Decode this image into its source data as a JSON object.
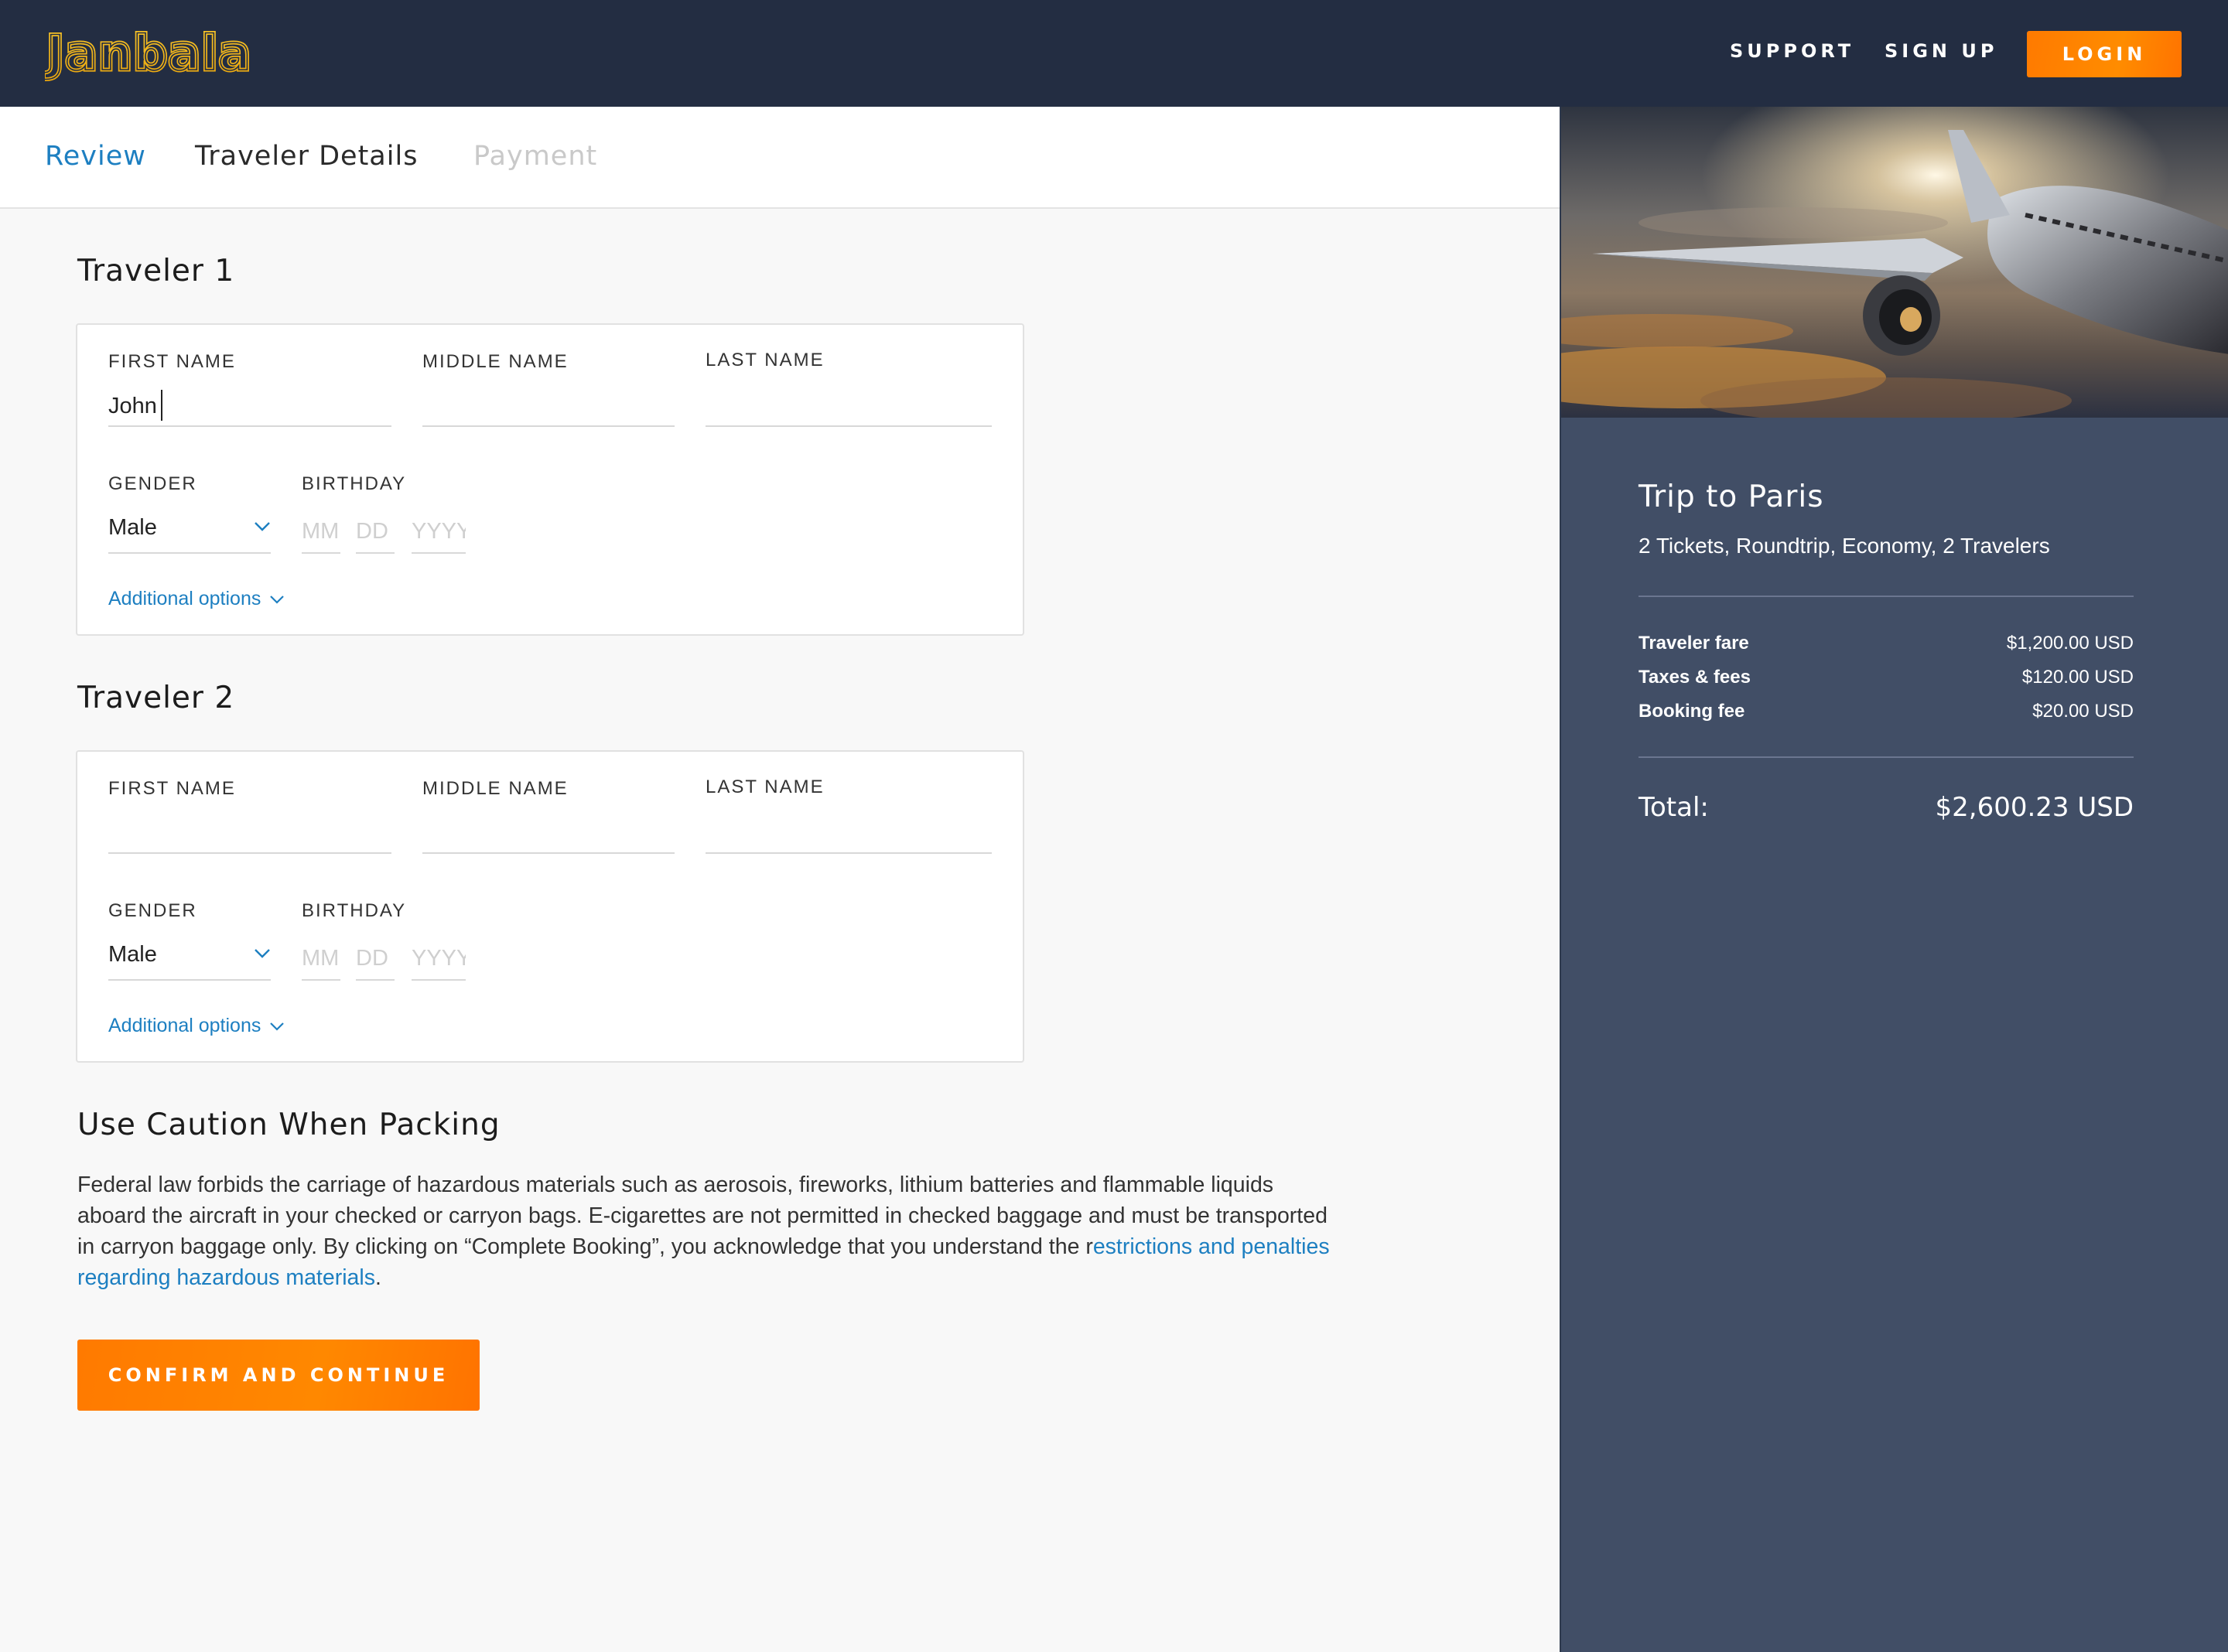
{
  "header": {
    "logo_text": "Janbala",
    "nav": {
      "support": "SUPPORT",
      "signup": "SIGN UP",
      "login": "LOGIN"
    }
  },
  "tabs": [
    {
      "label": "Review"
    },
    {
      "label": "Traveler Details"
    },
    {
      "label": "Payment"
    }
  ],
  "travelers": [
    {
      "title": "Traveler 1",
      "first_name_label": "FIRST NAME",
      "first_name_value": "John",
      "middle_name_label": "MIDDLE NAME",
      "last_name_label": "LAST NAME",
      "gender_label": "GENDER",
      "gender_value": "Male",
      "birthday_label": "BIRTHDAY",
      "mm_placeholder": "MM",
      "dd_placeholder": "DD",
      "yyyy_placeholder": "YYYY",
      "additional_options": "Additional options"
    },
    {
      "title": "Traveler 2",
      "first_name_label": "FIRST NAME",
      "first_name_value": "",
      "middle_name_label": "MIDDLE NAME",
      "last_name_label": "LAST NAME",
      "gender_label": "GENDER",
      "gender_value": "Male",
      "birthday_label": "BIRTHDAY",
      "mm_placeholder": "MM",
      "dd_placeholder": "DD",
      "yyyy_placeholder": "YYYY",
      "additional_options": "Additional options"
    }
  ],
  "caution": {
    "title": "Use Caution When Packing",
    "text_1": "Federal law forbids the carriage of hazardous materials such as aerosois, fireworks, lithium batteries and flammable liquids aboard the aircraft in your checked or carryon bags. E-cigarettes are not permitted in checked baggage and must be transported in carryon baggage only. By clicking on “Complete Booking”, you acknowledge that you understand the r",
    "link": "estrictions and penalties regarding hazardous materials",
    "text_2": "."
  },
  "confirm_button": "CONFIRM AND CONTINUE",
  "summary": {
    "title": "Trip to Paris",
    "subtitle": "2 Tickets, Roundtrip, Economy, 2 Travelers",
    "rows": [
      {
        "label": "Traveler fare",
        "amount": "$1,200.00 USD"
      },
      {
        "label": "Taxes & fees",
        "amount": "$120.00 USD"
      },
      {
        "label": "Booking fee",
        "amount": "$20.00 USD"
      }
    ],
    "total_label": "Total:",
    "total_amount": "$2,600.23 USD"
  },
  "colors": {
    "header_bg": "#232d42",
    "accent_orange": "#ff7a00",
    "link_blue": "#1d7fc1",
    "side_panel_bg": "#414e66",
    "logo_yellow": "#f6b416"
  },
  "icons": [
    "chevron-down-icon",
    "logo"
  ]
}
